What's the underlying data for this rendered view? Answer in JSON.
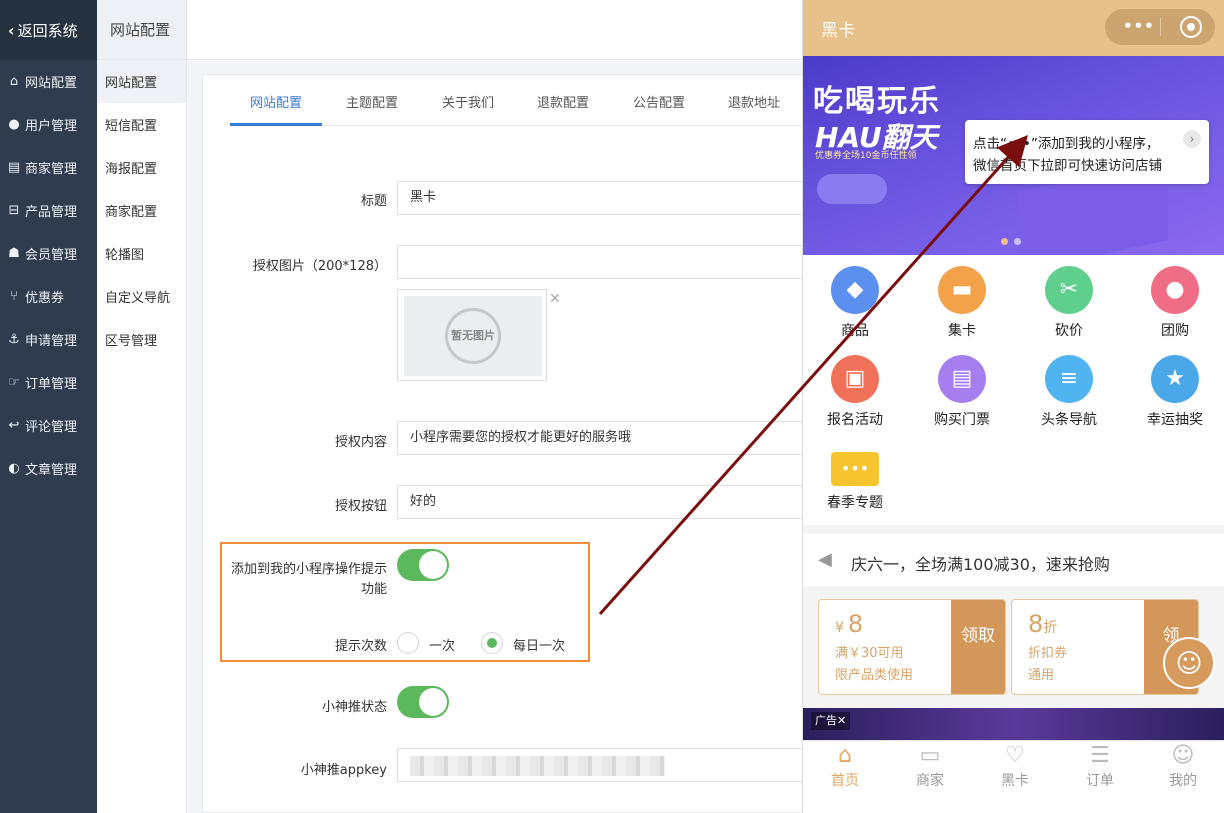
{
  "colors": {
    "sidebar": "#2e3c4e",
    "accent_blue": "#3a7bd5",
    "switch_on": "#5cb85c",
    "highlight": "#f08c3a",
    "phone_header": "#e7c189",
    "coupon": "#d4975a",
    "arrow": "#7a0f0f"
  },
  "sidebar": {
    "back_label": "返回系统",
    "items": [
      {
        "label": "网站配置",
        "icon": "home-icon"
      },
      {
        "label": "用户管理",
        "icon": "user-icon"
      },
      {
        "label": "商家管理",
        "icon": "store-icon"
      },
      {
        "label": "产品管理",
        "icon": "cart-icon"
      },
      {
        "label": "会员管理",
        "icon": "member-icon"
      },
      {
        "label": "优惠券",
        "icon": "coupon-icon"
      },
      {
        "label": "申请管理",
        "icon": "anchor-icon"
      },
      {
        "label": "订单管理",
        "icon": "order-icon"
      },
      {
        "label": "评论管理",
        "icon": "reply-icon"
      },
      {
        "label": "文章管理",
        "icon": "article-icon"
      }
    ]
  },
  "subbar": {
    "title": "网站配置",
    "items": [
      "网站配置",
      "短信配置",
      "海报配置",
      "商家配置",
      "轮播图",
      "自定义导航",
      "区号管理"
    ]
  },
  "tabs": [
    "网站配置",
    "主题配置",
    "关于我们",
    "退款配置",
    "公告配置",
    "退款地址"
  ],
  "form": {
    "title_label": "标题",
    "title_value": "黑卡",
    "auth_image_label": "授权图片（200*128）",
    "no_image_text": "暂无图片",
    "close_glyph": "✕",
    "auth_content_label": "授权内容",
    "auth_content_value": "小程序需要您的授权才能更好的服务哦",
    "auth_button_label": "授权按钮",
    "auth_button_value": "好的",
    "add_tip_label_1": "添加到我的小程序操作提示",
    "add_tip_label_2": "功能",
    "add_tip_enabled": true,
    "tip_count_label": "提示次数",
    "tip_count_options": [
      "一次",
      "每日一次"
    ],
    "tip_count_selected": "每日一次",
    "xiaoshen_status_label": "小神推状态",
    "xiaoshen_status_enabled": true,
    "xiaoshen_appkey_label": "小神推appkey"
  },
  "phone": {
    "title": "黑卡",
    "capsule_dots": "•••",
    "banner_line1": "吃喝玩乐",
    "banner_line2": "HAU翻天",
    "banner_line3": "优惠券全场10金币任性领",
    "tip_line1": "点击“•••”添加到我的小程序，",
    "tip_line2": "微信首页下拉即可快速访问店铺",
    "tip_close_glyph": "›",
    "grid": [
      {
        "label": "商品",
        "icon": "diamond-icon",
        "color": "#5b8ff0",
        "glyph": "◆"
      },
      {
        "label": "集卡",
        "icon": "cards-icon",
        "color": "#f4a24a",
        "glyph": "▬"
      },
      {
        "label": "砍价",
        "icon": "tag-icon",
        "color": "#5fcf8e",
        "glyph": "✂"
      },
      {
        "label": "团购",
        "icon": "group-icon",
        "color": "#f06d86",
        "glyph": "●"
      },
      {
        "label": "报名活动",
        "icon": "gift-icon",
        "color": "#f0715a",
        "glyph": "▣"
      },
      {
        "label": "购买门票",
        "icon": "ticket-icon",
        "color": "#a77ef0",
        "glyph": "▤"
      },
      {
        "label": "头条导航",
        "icon": "news-icon",
        "color": "#4fb4f0",
        "glyph": "≡"
      },
      {
        "label": "幸运抽奖",
        "icon": "award-icon",
        "color": "#4aa8e8",
        "glyph": "★"
      },
      {
        "label": "春季专题",
        "icon": "ticket-strip-icon",
        "color": "#f5c42e",
        "glyph": "•••"
      }
    ],
    "notice_icon": "speaker-icon",
    "notice_text": "庆六一，全场满100减30，速来抢购",
    "coupons": [
      {
        "currency": "¥",
        "amount": "8",
        "unit": "",
        "line1": "满￥30可用",
        "line2": "限产品类使用",
        "action": "领取"
      },
      {
        "currency": "",
        "amount": "8",
        "unit": "折",
        "line1": "折扣券",
        "line2": "通用",
        "action": "领"
      }
    ],
    "ad_tag": "广告✕",
    "tabbar": [
      {
        "label": "首页",
        "icon": "home-icon",
        "glyph": "⌂",
        "active": true
      },
      {
        "label": "商家",
        "icon": "shop-icon",
        "glyph": "▭",
        "active": false
      },
      {
        "label": "黑卡",
        "icon": "card-icon",
        "glyph": "♡",
        "active": false
      },
      {
        "label": "订单",
        "icon": "order-icon",
        "glyph": "☰",
        "active": false
      },
      {
        "label": "我的",
        "icon": "profile-icon",
        "glyph": "☺",
        "active": false
      }
    ]
  }
}
